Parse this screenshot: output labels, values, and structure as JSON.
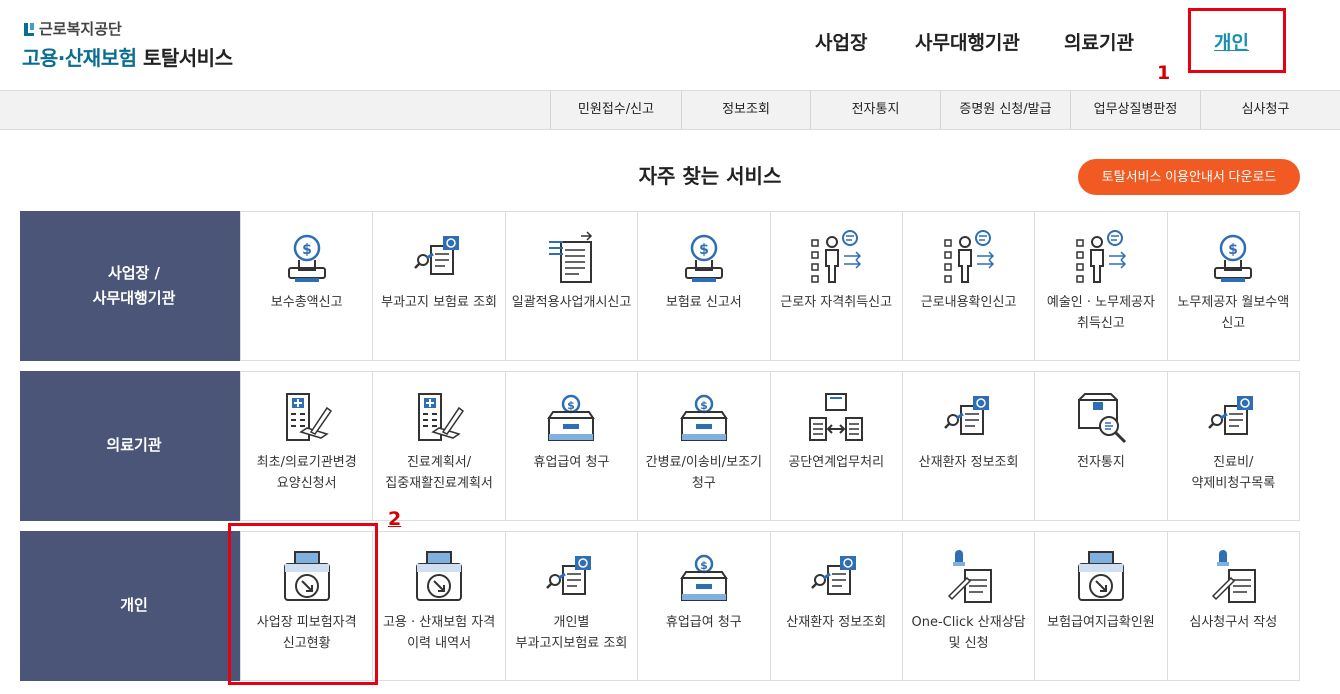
{
  "logo": {
    "org": "근로복지공단",
    "service_a": "고용·산재보험",
    "service_b": "토탈서비스"
  },
  "topnav": [
    {
      "label": "사업장"
    },
    {
      "label": "사무대행기관"
    },
    {
      "label": "의료기관"
    },
    {
      "label": "개인",
      "active": true
    }
  ],
  "annotations": {
    "one": "1",
    "two": "2"
  },
  "subnav": [
    "민원접수/신고",
    "정보조회",
    "전자통지",
    "증명원 신청/발급",
    "업무상질병판정",
    "심사청구"
  ],
  "section": {
    "title": "자주 찾는 서비스",
    "download": "토탈서비스 이용안내서 다운로드"
  },
  "rows": [
    {
      "label": "사업장 /\n사무대행기관",
      "items": [
        {
          "label": "보수총액신고",
          "icon": "money-bulb-icon"
        },
        {
          "label": "부과고지 보험료 조회",
          "icon": "document-search-icon"
        },
        {
          "label": "일괄적용사업개시신고",
          "icon": "document-list-icon"
        },
        {
          "label": "보험료 신고서",
          "icon": "money-bulb-icon"
        },
        {
          "label": "근로자 자격취득신고",
          "icon": "person-checklist-icon"
        },
        {
          "label": "근로내용확인신고",
          "icon": "person-checklist-icon"
        },
        {
          "label": "예술인 · 노무제공자 취득신고",
          "icon": "person-checklist-icon"
        },
        {
          "label": "노무제공자 월보수액 신고",
          "icon": "money-bulb-icon"
        }
      ]
    },
    {
      "label": "의료기관",
      "items": [
        {
          "label": "최초/의료기관변경 요양신청서",
          "icon": "hospital-pen-icon"
        },
        {
          "label": "진료계획서/집중재활진료계획서",
          "icon": "hospital-pen-icon"
        },
        {
          "label": "휴업급여 청구",
          "icon": "money-box-icon"
        },
        {
          "label": "간병료/이송비/보조기 청구",
          "icon": "money-box-icon"
        },
        {
          "label": "공단연계업무처리",
          "icon": "document-exchange-icon"
        },
        {
          "label": "산재환자 정보조회",
          "icon": "document-search-icon"
        },
        {
          "label": "전자통지",
          "icon": "box-magnifier-icon"
        },
        {
          "label": "진료비/약제비청구목록",
          "icon": "document-search-icon"
        }
      ]
    },
    {
      "label": "개인",
      "items": [
        {
          "label": "사업장 피보험자격 신고현황",
          "icon": "printer-arrow-icon"
        },
        {
          "label": "고용 · 산재보험 자격 이력 내역서",
          "icon": "printer-arrow-icon"
        },
        {
          "label": "개인별 부과고지보험료 조회",
          "icon": "document-search-icon"
        },
        {
          "label": "휴업급여 청구",
          "icon": "money-box-icon"
        },
        {
          "label": "산재환자 정보조회",
          "icon": "document-search-icon"
        },
        {
          "label": "One-Click 산재상담 및 신청",
          "icon": "stamp-document-icon"
        },
        {
          "label": "보험급여지급확인원",
          "icon": "printer-arrow-icon"
        },
        {
          "label": "심사청구서 작성",
          "icon": "stamp-document-icon"
        }
      ]
    }
  ],
  "colors": {
    "accent": "#1a8fb0",
    "brand": "#0b6e8f",
    "label_bg": "#4a5577",
    "button": "#f15a22",
    "highlight": "#e60012",
    "icon_blue": "#2e6eb4"
  }
}
